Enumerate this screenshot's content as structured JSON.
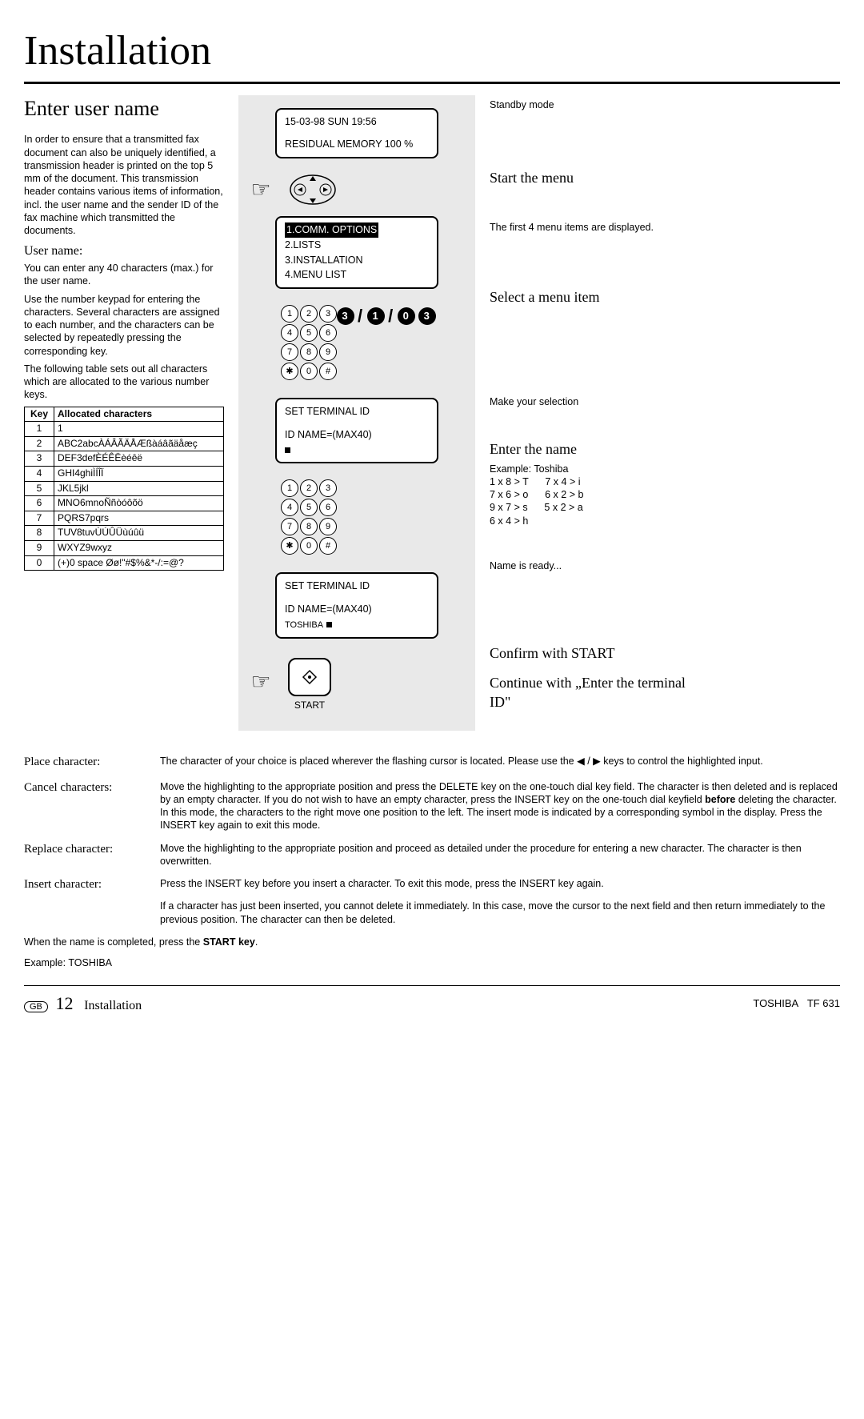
{
  "title": "Installation",
  "section_heading": "Enter user name",
  "intro_para": "In order to ensure that a transmitted fax document can also be uniquely identified, a transmission header is printed on the top 5 mm of the document. This transmission header contains various items of information, incl. the user name and the sender ID of the fax machine which transmitted the documents.",
  "username_heading": "User name:",
  "username_p1": "You can enter any 40 characters (max.) for the user name.",
  "username_p2": "Use the number keypad for entering the characters. Several characters are assigned to each number, and the characters can be selected by repeatedly pressing the corresponding key.",
  "username_p3": "The following table sets out all characters which are allocated to the various number keys.",
  "table_headers": {
    "col1": "Key",
    "col2": "Allocated characters"
  },
  "table_rows": [
    {
      "k": "1",
      "v": "1"
    },
    {
      "k": "2",
      "v": "ABC2abcÀÁÂÃÄÅÆßàáâãäåæç"
    },
    {
      "k": "3",
      "v": "DEF3defÈÉÊËèéêë"
    },
    {
      "k": "4",
      "v": "GHI4ghiÌÍÎÏ"
    },
    {
      "k": "5",
      "v": "JKL5jkl"
    },
    {
      "k": "6",
      "v": "MNO6mnoÑñòóôõö"
    },
    {
      "k": "7",
      "v": "PQRS7pqrs"
    },
    {
      "k": "8",
      "v": "TUV8tuvÙÚÛÜùúûü"
    },
    {
      "k": "9",
      "v": "WXYZ9wxyz"
    },
    {
      "k": "0",
      "v": "(+)0 space Øø!\"#$%&*-/:=@?"
    }
  ],
  "lcd1": {
    "line1": "15-03-98   SUN   19:56",
    "line2": "RESIDUAL MEMORY 100 %"
  },
  "lcd2": {
    "l1": "1.COMM. OPTIONS",
    "l2": "2.LISTS",
    "l3": "3.INSTALLATION",
    "l4": "4.MENU LIST"
  },
  "lcd3": {
    "l1": "SET TERMINAL ID",
    "l2": "ID NAME=(MAX40)"
  },
  "lcd4": {
    "l1": "SET TERMINAL ID",
    "l2": "ID NAME=(MAX40)",
    "l3": "TOSHIBA"
  },
  "seq": {
    "a": "3",
    "b": "1",
    "c": "0",
    "d": "3"
  },
  "start_label": "START",
  "right": {
    "standby": "Standby mode",
    "start_menu_h": "Start the menu",
    "first4": "The first 4 menu items are displayed.",
    "select_h": "Select a menu item",
    "make_sel": "Make your selection",
    "enter_name_h": "Enter the name",
    "example_label": "Example: Toshiba",
    "ex_lines": [
      "1 x 8 > T      7 x 4 > i",
      "7 x 6 > o      6 x 2 > b",
      "9 x 7 > s      5 x 2 > a",
      "6 x 4 > h"
    ],
    "name_ready": "Name is ready...",
    "confirm_h": "Confirm with START",
    "continue_h": "Continue with „Enter the terminal ID\""
  },
  "instructions": {
    "place_label": "Place character:",
    "place_text_a": "The character of your choice is placed wherever the flashing cursor is located. Please use the ",
    "place_text_b": " keys to control the highlighted input.",
    "cancel_label": "Cancel characters:",
    "cancel_text_a": "Move the highlighting to the appropriate position and press the DELETE key on the one-touch dial key field. The character is then deleted and is replaced by an empty character. If you do not wish to have an empty character, press the INSERT key on the one-touch dial keyfield ",
    "cancel_bold": "before",
    "cancel_text_b": " deleting the character. In this mode, the characters to the right move one position to the left. The insert mode is indicated by a corresponding symbol in the display. Press the INSERT key again to exit this mode.",
    "replace_label": "Replace character:",
    "replace_text": "Move the highlighting to the appropriate position and proceed as detailed under the procedure for entering a new character. The character is then overwritten.",
    "insert_label": "Insert character:",
    "insert_text": "Press the INSERT key before you insert a character. To exit this mode, press the INSERT key again.",
    "insert_note": "If a character has just been inserted, you cannot delete it immediately. In this case, move the cursor to the next field and then return immediately to the previous position. The character can then be deleted."
  },
  "completion_a": "When the name is completed, press the ",
  "completion_b": "START key",
  "completion_c": ".",
  "example_final": "Example: TOSHIBA",
  "footer": {
    "gb": "GB",
    "page": "12",
    "section": "Installation",
    "brand": "TOSHIBA",
    "model": "TF 631"
  }
}
